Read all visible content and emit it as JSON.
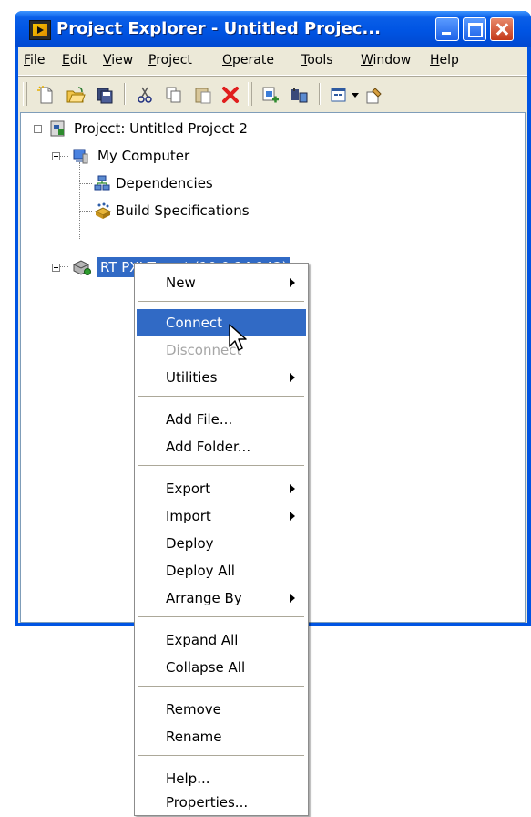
{
  "window": {
    "title": "Project Explorer - Untitled Projec...",
    "controls": [
      "minimize-icon",
      "maximize-icon",
      "close-icon"
    ]
  },
  "menubar": {
    "items": [
      {
        "label": "File",
        "accel": "F",
        "rest": "ile"
      },
      {
        "label": "Edit",
        "accel": "E",
        "rest": "dit"
      },
      {
        "label": "View",
        "accel": "V",
        "rest": "iew"
      },
      {
        "label": "Project",
        "accel": "P",
        "rest": "roject"
      },
      {
        "label": "Operate",
        "accel": "O",
        "rest": "perate"
      },
      {
        "label": "Tools",
        "accel": "T",
        "rest": "ools"
      },
      {
        "label": "Window",
        "accel": "W",
        "rest": "indow"
      },
      {
        "label": "Help",
        "accel": "H",
        "rest": "elp"
      }
    ]
  },
  "toolbar": {
    "icons": [
      "new-icon",
      "open-icon",
      "save-all-icon",
      "cut-icon",
      "copy-icon",
      "paste-icon",
      "delete-icon",
      "add-to-project-icon",
      "build-icon",
      "view-dropdown-icon",
      "project-properties-icon"
    ]
  },
  "tree": {
    "project": "Project: Untitled Project 2",
    "my_computer": "My Computer",
    "dependencies": "Dependencies",
    "build_specifications": "Build Specifications",
    "rt_target": "RT PXI Target (10.0.14.142)"
  },
  "context_menu": {
    "new": "New",
    "connect": "Connect",
    "disconnect": "Disconnect",
    "utilities": "Utilities",
    "add_file": "Add File...",
    "add_folder": "Add Folder...",
    "export": "Export",
    "import": "Import",
    "deploy": "Deploy",
    "deploy_all": "Deploy All",
    "arrange_by": "Arrange By",
    "expand_all": "Expand All",
    "collapse_all": "Collapse All",
    "remove": "Remove",
    "rename": "Rename",
    "help": "Help...",
    "properties": "Properties..."
  },
  "colors": {
    "titlebar": "#0054e3",
    "selection": "#316ac5",
    "face": "#ece9d8"
  }
}
